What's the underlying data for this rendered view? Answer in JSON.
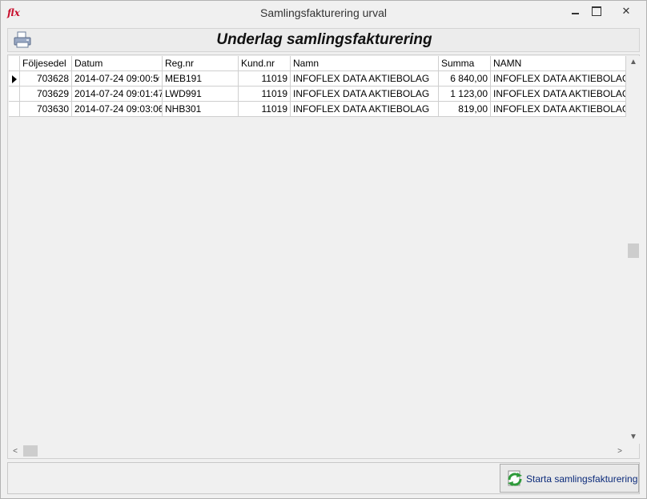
{
  "window": {
    "title": "Samlingsfakturering urval",
    "app_icon_text": "flx",
    "close_glyph": "✕"
  },
  "header": {
    "title": "Underlag samlingsfakturering",
    "icon": "printer-icon"
  },
  "grid": {
    "columns": [
      "Följesedel",
      "Datum",
      "Reg.nr",
      "Kund.nr",
      "Namn",
      "Summa",
      "NAMN"
    ],
    "rows": [
      {
        "foljesedel": "703628",
        "datum": "2014-07-24 09:00:5",
        "regnr": "MEB191",
        "kundnr": "11019",
        "namn": "INFOFLEX DATA AKTIEBOLAG",
        "summa": "6 840,00",
        "namn2": "INFOFLEX DATA AKTIEBOLAG"
      },
      {
        "foljesedel": "703629",
        "datum": "2014-07-24 09:01:47",
        "regnr": "LWD991",
        "kundnr": "11019",
        "namn": "INFOFLEX DATA AKTIEBOLAG",
        "summa": "1 123,00",
        "namn2": "INFOFLEX DATA AKTIEBOLAG"
      },
      {
        "foljesedel": "703630",
        "datum": "2014-07-24 09:03:06",
        "regnr": "NHB301",
        "kundnr": "11019",
        "namn": "INFOFLEX DATA AKTIEBOLAG",
        "summa": "819,00",
        "namn2": "INFOFLEX DATA AKTIEBOLAG"
      }
    ],
    "dropdown_glyph": "∨",
    "scroll_up": "▲",
    "scroll_down": "▼",
    "scroll_left": "<",
    "scroll_right": ">"
  },
  "footer": {
    "start_button_label": "Starta samlingsfakturering",
    "start_button_icon": "refresh-icon"
  },
  "colors": {
    "title_accent": "#c8102e",
    "button_text": "#0b2a7a"
  }
}
